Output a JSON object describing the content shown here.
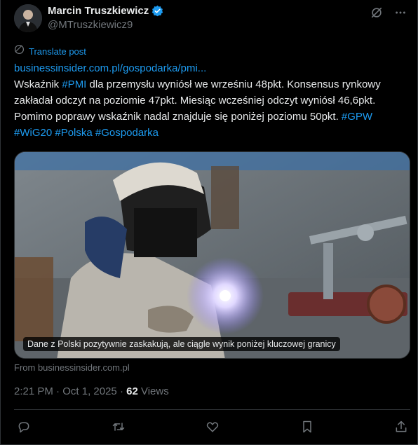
{
  "author": {
    "display_name": "Marcin Truszkiewicz",
    "handle": "@MTruszkiewicz9",
    "verified": true,
    "avatar_icon": "user-avatar-photo"
  },
  "translate": {
    "label": "Translate post",
    "icon": "globe-icon"
  },
  "post": {
    "link": "businessinsider.com.pl/gospodarka/pmi...",
    "text_segments": [
      {
        "text": "Wskaźnik ",
        "kind": "text"
      },
      {
        "text": "#PMI",
        "kind": "tag"
      },
      {
        "text": " dla przemysłu wyniósł we wrześniu 48pkt. Konsensus rynkowy zakładał odczyt na poziomie 47pkt. Miesiąc wcześniej odczyt wyniósł 46,6pkt. Pomimo poprawy wskaźnik nadal znajduje się poniżej poziomu 50pkt. ",
        "kind": "text"
      },
      {
        "text": "#GPW",
        "kind": "tag"
      },
      {
        "text": " ",
        "kind": "text"
      },
      {
        "text": "#WiG20",
        "kind": "tag"
      },
      {
        "text": " ",
        "kind": "text"
      },
      {
        "text": "#Polska",
        "kind": "tag"
      },
      {
        "text": " ",
        "kind": "text"
      },
      {
        "text": "#Gospodarka",
        "kind": "tag"
      }
    ]
  },
  "media": {
    "caption": "Dane z Polski pozytywnie zaskakują, ale ciągle wynik poniżej kluczowej granicy",
    "source": "From businessinsider.com.pl"
  },
  "meta": {
    "time": "2:21 PM",
    "separator": " · ",
    "date": "Oct 1, 2025",
    "views_count": "62",
    "views_label": " Views"
  },
  "actions": [
    "reply-icon",
    "repost-icon",
    "like-icon",
    "bookmark-icon",
    "share-icon"
  ],
  "colors": {
    "background": "#000000",
    "text": "#e7e9ea",
    "muted": "#71767b",
    "accent": "#1d9bf0",
    "border": "#2f3336"
  }
}
